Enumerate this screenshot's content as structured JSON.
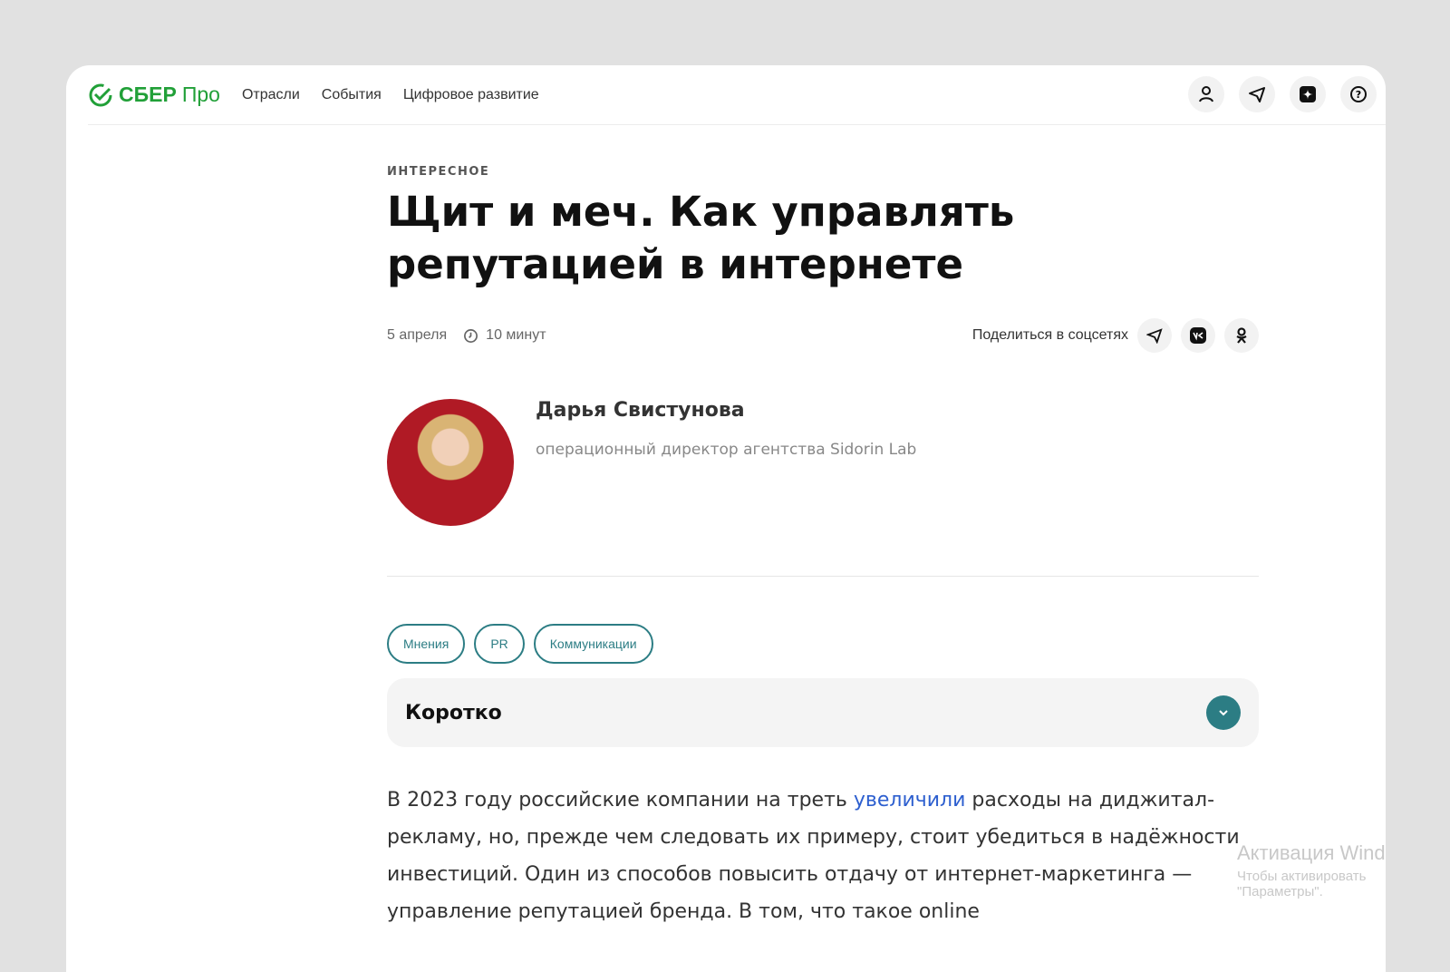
{
  "header": {
    "logo": "СБЕР",
    "logo_suffix": "Про",
    "nav": [
      "Отрасли",
      "События",
      "Цифровое развитие"
    ]
  },
  "article": {
    "rubric": "ИНТЕРЕСНОЕ",
    "title": "Щит и меч. Как управлять репутацией в интернете",
    "date": "5 апреля",
    "read_time": "10 минут",
    "share_label": "Поделиться в соцсетях",
    "author": {
      "name": "Дарья Свистунова",
      "role": "операционный директор агентства Sidorin Lab"
    },
    "tags": [
      "Мнения",
      "PR",
      "Коммуникации"
    ],
    "summary_label": "Коротко",
    "para_before": "В 2023 году российские компании на треть ",
    "para_link": "увеличили",
    "para_after": " расходы на диджитал-рекламу, но, прежде чем следовать их примеру, стоит убедиться в надёжности инвестиций. Один из способов повысить отдачу от интернет-маркетинга — управление репутацией бренда. В том, что такое online"
  },
  "watermark": {
    "title": "Активация Windows",
    "sub": "Чтобы активировать",
    "sub2": "\"Параметры\"."
  }
}
